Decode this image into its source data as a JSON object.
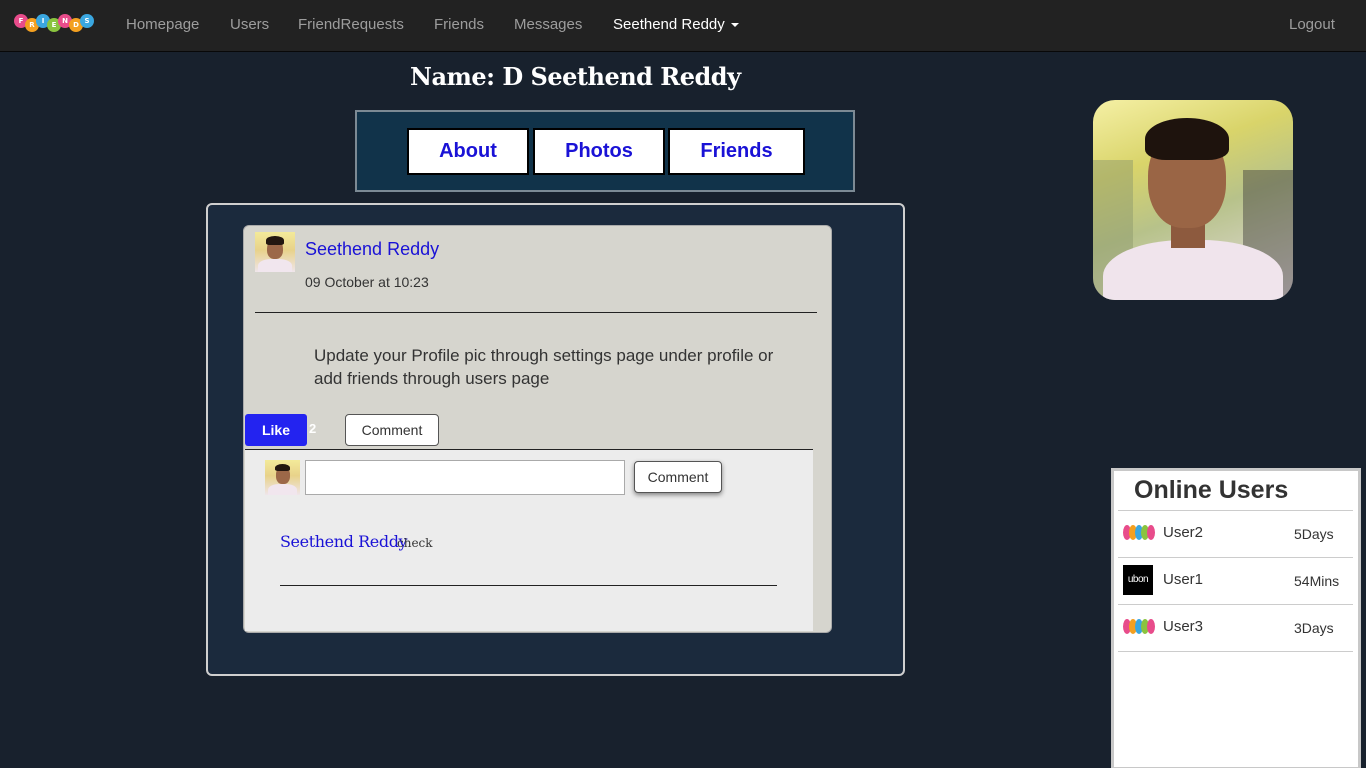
{
  "nav": {
    "brand_letters": [
      "F",
      "R",
      "I",
      "E",
      "N",
      "D",
      "S"
    ],
    "brand_colors": [
      "#e84c8b",
      "#f4a020",
      "#3aa7e0",
      "#8ac43f",
      "#e84c8b",
      "#f4a020",
      "#3aa7e0"
    ],
    "links": [
      "Homepage",
      "Users",
      "FriendRequests",
      "Friends",
      "Messages"
    ],
    "user_menu": "Seethend Reddy",
    "logout": "Logout"
  },
  "profile": {
    "name": "Name:  D Seethend Reddy",
    "tabs": [
      "About",
      "Photos",
      "Friends"
    ]
  },
  "post": {
    "author": "Seethend Reddy",
    "time": "09 October at 10:23",
    "text": "Update your Profile pic through settings page under profile or add friends through users page",
    "like_label": "Like",
    "like_count": "2",
    "comment_label": "Comment",
    "comment_submit_label": "Comment",
    "comment_placeholder": "",
    "comments": [
      {
        "author": "Seethend Reddy",
        "text": "check"
      }
    ]
  },
  "online": {
    "title": "Online Users",
    "users": [
      {
        "name": "User2",
        "last_seen": "5Days",
        "icon": "friends-logo-icon"
      },
      {
        "name": "User1",
        "last_seen": "54Mins",
        "icon": "ubon-logo-icon",
        "icon_text": "ubon"
      },
      {
        "name": "User3",
        "last_seen": "3Days",
        "icon": "friends-logo-icon"
      }
    ]
  },
  "colors": {
    "page_bg": "#18212d",
    "navbar_bg": "#222222",
    "link_blue": "#1a12d6",
    "like_blue": "#2323f0",
    "tabs_bg": "#11334a"
  }
}
